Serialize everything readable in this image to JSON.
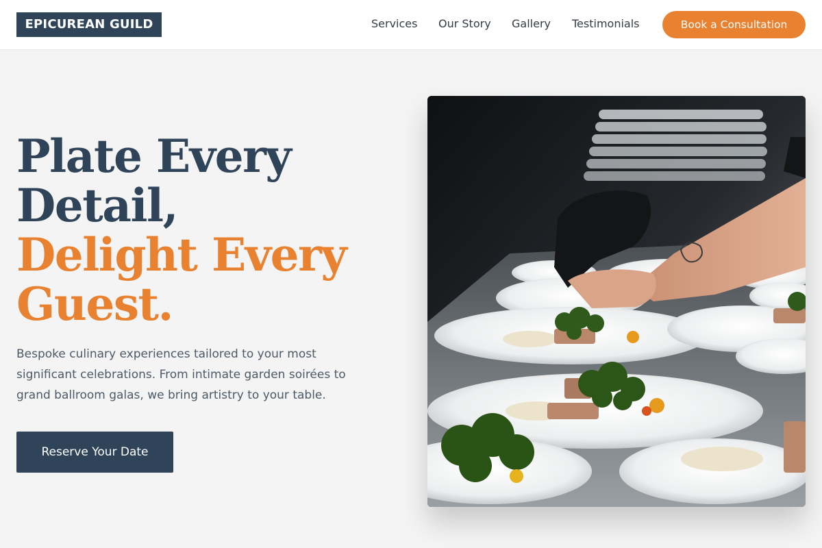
{
  "brand": {
    "name": "EPICUREAN GUILD"
  },
  "nav": {
    "links": [
      "Services",
      "Our Story",
      "Gallery",
      "Testimonials"
    ],
    "cta_label": "Book a Consultation"
  },
  "hero": {
    "title_lines_dark": [
      "Plate Every",
      "Detail,"
    ],
    "title_lines_accent": [
      "Delight Every",
      "Guest."
    ],
    "subtitle_lines": [
      "Bespoke culinary experiences tailored to your most",
      "significant celebrations. From intimate garden soirées to",
      "grand ballroom galas, we bring artistry to your table."
    ],
    "button_label": "Reserve Your Date",
    "image": {
      "subject": "chef-plating-dishes-photo",
      "alt": ""
    }
  },
  "colors": {
    "navy": "#2f4459",
    "accent": "#e98230",
    "background": "#f3f4f3",
    "header_bg": "#ffffff"
  }
}
